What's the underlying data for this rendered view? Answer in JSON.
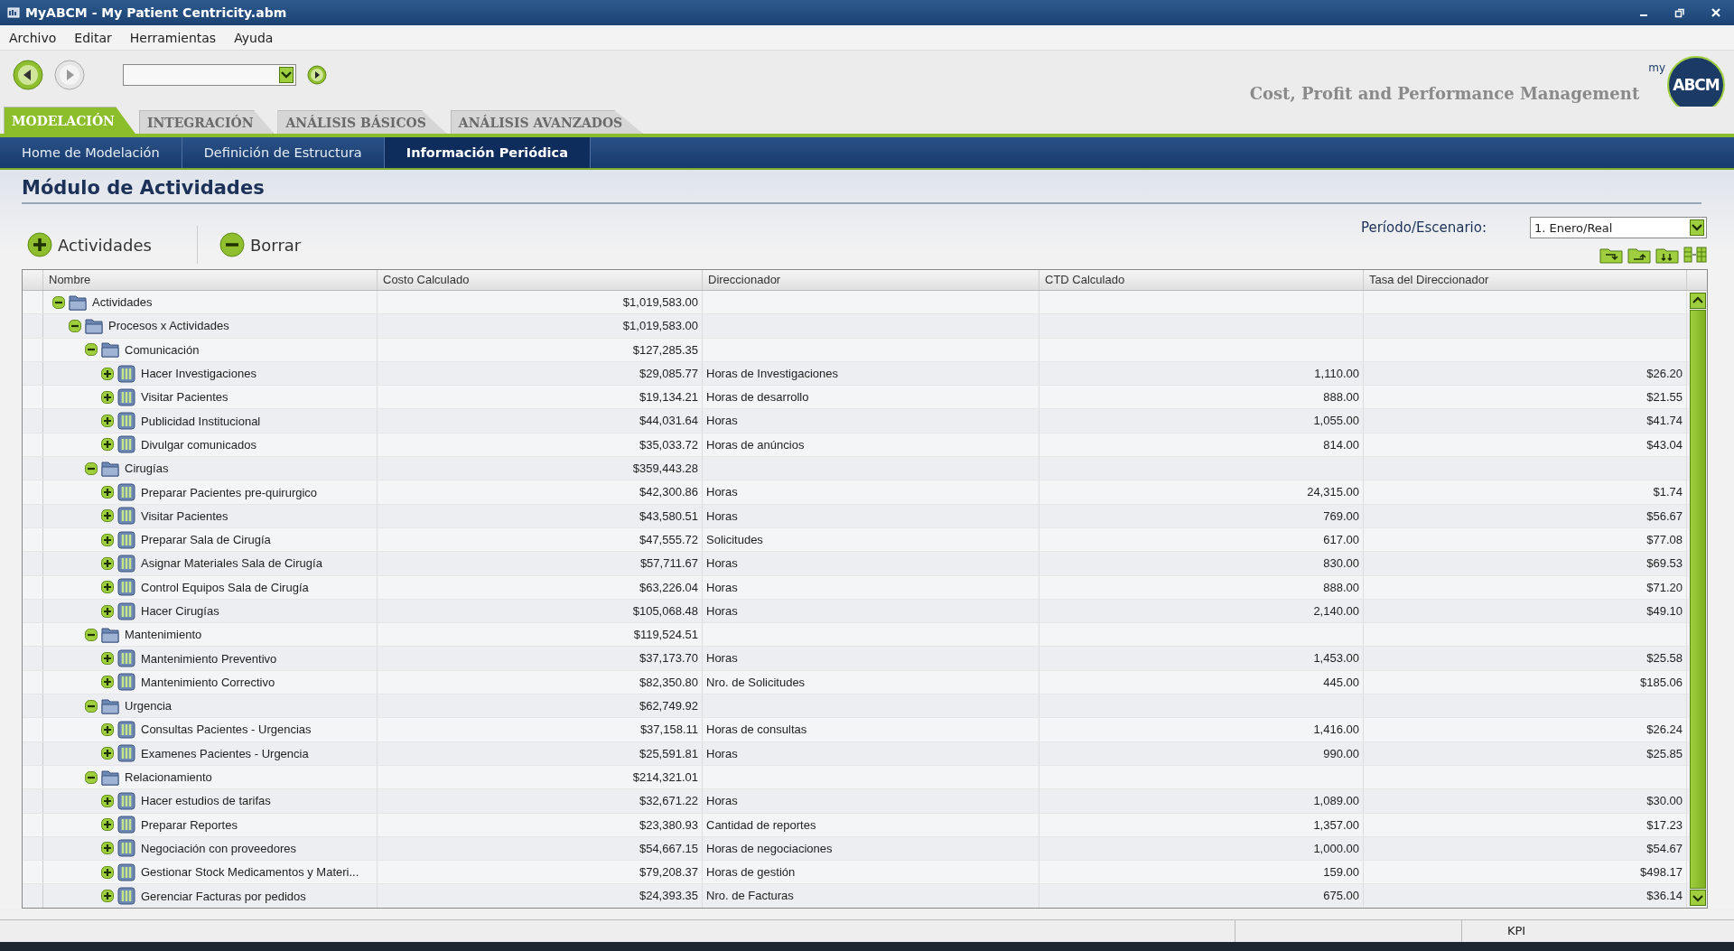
{
  "window": {
    "title": "MyABCM  - My Patient Centricity.abm"
  },
  "menu": [
    "Archivo",
    "Editar",
    "Herramientas",
    "Ayuda"
  ],
  "toolbar": {
    "tagline": "Cost, Profit and Performance Management",
    "logo": {
      "prefix": "my",
      "text": "ABCM"
    }
  },
  "tabs": [
    {
      "label": "MODELACIÓN",
      "selected": true
    },
    {
      "label": "INTEGRACIÓN",
      "selected": false
    },
    {
      "label": "ANÁLISIS BÁSICOS",
      "selected": false
    },
    {
      "label": "ANÁLISIS AVANZADOS",
      "selected": false
    }
  ],
  "nav": [
    {
      "label": "Home de Modelación",
      "selected": false
    },
    {
      "label": "Definición de Estructura",
      "selected": false
    },
    {
      "label": "Información Periódica",
      "selected": true
    }
  ],
  "page": {
    "title": "Módulo de Actividades",
    "add_button": "Actividades",
    "delete_button": "Borrar",
    "period_label": "Período/Escenario:",
    "period_value": "1. Enero/Real"
  },
  "table": {
    "columns": [
      "Nombre",
      "Costo Calculado",
      "Direccionador",
      "CTD Calculado",
      "Tasa del Direccionador"
    ],
    "tree": [
      {
        "kind": "folder",
        "expanded": true,
        "name": "Actividades",
        "cost": "$1,019,583.00",
        "children": [
          {
            "kind": "folder",
            "expanded": true,
            "name": "Procesos x Actividades",
            "cost": "$1,019,583.00",
            "children": [
              {
                "kind": "folder",
                "expanded": true,
                "name": "Comunicación",
                "cost": "$127,285.35",
                "children": [
                  {
                    "kind": "activity",
                    "expanded": false,
                    "name": "Hacer Investigaciones",
                    "cost": "$29,085.77",
                    "driver": "Horas de Investigaciones",
                    "qty": "1,110.00",
                    "rate": "$26.20"
                  },
                  {
                    "kind": "activity",
                    "expanded": false,
                    "name": "Visitar Pacientes",
                    "cost": "$19,134.21",
                    "driver": "Horas de desarrollo",
                    "qty": "888.00",
                    "rate": "$21.55"
                  },
                  {
                    "kind": "activity",
                    "expanded": false,
                    "name": "Publicidad Institucional",
                    "cost": "$44,031.64",
                    "driver": "Horas",
                    "qty": "1,055.00",
                    "rate": "$41.74"
                  },
                  {
                    "kind": "activity",
                    "expanded": false,
                    "name": "Divulgar comunicados",
                    "cost": "$35,033.72",
                    "driver": "Horas de anúncios",
                    "qty": "814.00",
                    "rate": "$43.04"
                  }
                ]
              },
              {
                "kind": "folder",
                "expanded": true,
                "name": "Cirugías",
                "cost": "$359,443.28",
                "children": [
                  {
                    "kind": "activity",
                    "expanded": false,
                    "name": "Preparar Pacientes pre-quirurgico",
                    "cost": "$42,300.86",
                    "driver": "Horas",
                    "qty": "24,315.00",
                    "rate": "$1.74"
                  },
                  {
                    "kind": "activity",
                    "expanded": false,
                    "name": "Visitar Pacientes",
                    "cost": "$43,580.51",
                    "driver": "Horas",
                    "qty": "769.00",
                    "rate": "$56.67"
                  },
                  {
                    "kind": "activity",
                    "expanded": false,
                    "name": "Preparar Sala de Cirugía",
                    "cost": "$47,555.72",
                    "driver": "Solicitudes",
                    "qty": "617.00",
                    "rate": "$77.08"
                  },
                  {
                    "kind": "activity",
                    "expanded": false,
                    "name": "Asignar Materiales Sala de Cirugía",
                    "cost": "$57,711.67",
                    "driver": "Horas",
                    "qty": "830.00",
                    "rate": "$69.53"
                  },
                  {
                    "kind": "activity",
                    "expanded": false,
                    "name": "Control Equipos Sala de Cirugía",
                    "cost": "$63,226.04",
                    "driver": "Horas",
                    "qty": "888.00",
                    "rate": "$71.20"
                  },
                  {
                    "kind": "activity",
                    "expanded": false,
                    "name": "Hacer Cirugías",
                    "cost": "$105,068.48",
                    "driver": "Horas",
                    "qty": "2,140.00",
                    "rate": "$49.10"
                  }
                ]
              },
              {
                "kind": "folder",
                "expanded": true,
                "name": "Mantenimiento",
                "cost": "$119,524.51",
                "children": [
                  {
                    "kind": "activity",
                    "expanded": false,
                    "name": "Mantenimiento Preventivo",
                    "cost": "$37,173.70",
                    "driver": "Horas",
                    "qty": "1,453.00",
                    "rate": "$25.58"
                  },
                  {
                    "kind": "activity",
                    "expanded": false,
                    "name": "Mantenimiento Correctivo",
                    "cost": "$82,350.80",
                    "driver": "Nro. de Solicitudes",
                    "qty": "445.00",
                    "rate": "$185.06"
                  }
                ]
              },
              {
                "kind": "folder",
                "expanded": true,
                "name": "Urgencia",
                "cost": "$62,749.92",
                "children": [
                  {
                    "kind": "activity",
                    "expanded": false,
                    "name": "Consultas Pacientes - Urgencias",
                    "cost": "$37,158.11",
                    "driver": "Horas de consultas",
                    "qty": "1,416.00",
                    "rate": "$26.24"
                  },
                  {
                    "kind": "activity",
                    "expanded": false,
                    "name": "Examenes Pacientes - Urgencia",
                    "cost": "$25,591.81",
                    "driver": "Horas",
                    "qty": "990.00",
                    "rate": "$25.85"
                  }
                ]
              },
              {
                "kind": "folder",
                "expanded": true,
                "name": "Relacionamiento",
                "cost": "$214,321.01",
                "children": [
                  {
                    "kind": "activity",
                    "expanded": false,
                    "name": "Hacer estudios de tarifas",
                    "cost": "$32,671.22",
                    "driver": "Horas",
                    "qty": "1,089.00",
                    "rate": "$30.00"
                  },
                  {
                    "kind": "activity",
                    "expanded": false,
                    "name": "Preparar Reportes",
                    "cost": "$23,380.93",
                    "driver": "Cantidad de reportes",
                    "qty": "1,357.00",
                    "rate": "$17.23"
                  },
                  {
                    "kind": "activity",
                    "expanded": false,
                    "name": "Negociación con proveedores",
                    "cost": "$54,667.15",
                    "driver": "Horas de negociaciones",
                    "qty": "1,000.00",
                    "rate": "$54.67"
                  },
                  {
                    "kind": "activity",
                    "expanded": false,
                    "name": "Gestionar Stock Medicamentos y Materi...",
                    "cost": "$79,208.37",
                    "driver": "Horas de gestión",
                    "qty": "159.00",
                    "rate": "$498.17"
                  },
                  {
                    "kind": "activity",
                    "expanded": false,
                    "name": "Gerenciar Facturas por pedidos",
                    "cost": "$24,393.35",
                    "driver": "Nro. de Facturas",
                    "qty": "675.00",
                    "rate": "$36.14"
                  }
                ]
              }
            ]
          }
        ]
      }
    ]
  },
  "status_bar": {
    "panel": "KPI"
  }
}
